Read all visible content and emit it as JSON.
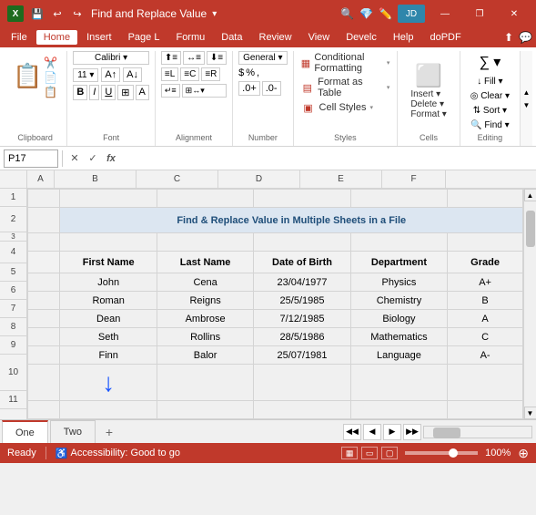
{
  "titleBar": {
    "title": "Find and Replace Value",
    "excelLabel": "X",
    "controls": [
      "—",
      "❐",
      "✕"
    ]
  },
  "quickAccess": {
    "buttons": [
      "💾",
      "↩",
      "↪"
    ]
  },
  "menuBar": {
    "items": [
      "File",
      "Home",
      "Insert",
      "Page L",
      "Formu",
      "Data",
      "Review",
      "View",
      "Develc",
      "Help",
      "doPDF"
    ]
  },
  "ribbon": {
    "groups": [
      {
        "name": "Clipboard",
        "label": "Clipboard",
        "icon": "📋"
      },
      {
        "name": "Font",
        "label": "Font",
        "icon": "A"
      },
      {
        "name": "Alignment",
        "label": "Alignment",
        "icon": "≡"
      },
      {
        "name": "Number",
        "label": "Number",
        "icon": "%"
      },
      {
        "name": "Styles",
        "label": "Styles",
        "items": [
          {
            "label": "Conditional Formatting",
            "icon": "▦",
            "arrow": "▾"
          },
          {
            "label": "Format as Table",
            "icon": "▤",
            "arrow": "▾"
          },
          {
            "label": "Cell Styles",
            "icon": "▣",
            "arrow": "▾"
          }
        ]
      },
      {
        "name": "Cells",
        "label": "Cells",
        "icon": "⬜"
      },
      {
        "name": "Editing",
        "label": "Editing",
        "icon": "∑"
      }
    ],
    "stylesLabel": "Styles"
  },
  "formulaBar": {
    "cellRef": "P17",
    "cancelBtn": "✕",
    "confirmBtn": "✓",
    "functionBtn": "fx",
    "value": ""
  },
  "columns": {
    "headers": [
      "A",
      "B",
      "C",
      "D",
      "E",
      "F"
    ],
    "widths": [
      30,
      90,
      90,
      90,
      90,
      70
    ]
  },
  "rows": {
    "numbers": [
      1,
      2,
      3,
      4,
      5,
      6,
      7,
      8,
      9,
      10,
      11
    ],
    "heights": [
      20,
      28,
      10,
      24,
      20,
      20,
      20,
      20,
      20,
      40,
      20
    ]
  },
  "spreadsheet": {
    "title": "Find & Replace Value in Multiple Sheets in a File",
    "headers": [
      "First Name",
      "Last Name",
      "Date of Birth",
      "Department",
      "Grade"
    ],
    "data": [
      [
        "John",
        "Cena",
        "23/04/1977",
        "Physics",
        "A+"
      ],
      [
        "Roman",
        "Reigns",
        "25/5/1985",
        "Chemistry",
        "B"
      ],
      [
        "Dean",
        "Ambrose",
        "7/12/1985",
        "Biology",
        "A"
      ],
      [
        "Seth",
        "Rollins",
        "28/5/1986",
        "Mathematics",
        "C"
      ],
      [
        "Finn",
        "Balor",
        "25/07/1981",
        "Language",
        "A-"
      ]
    ]
  },
  "sheetTabs": {
    "tabs": [
      "One",
      "Two"
    ],
    "activeTab": "One"
  },
  "statusBar": {
    "ready": "Ready",
    "accessibility": "Accessibility: Good to go",
    "zoom": "100%",
    "viewIcons": [
      "▦",
      "▭",
      "▢"
    ]
  }
}
